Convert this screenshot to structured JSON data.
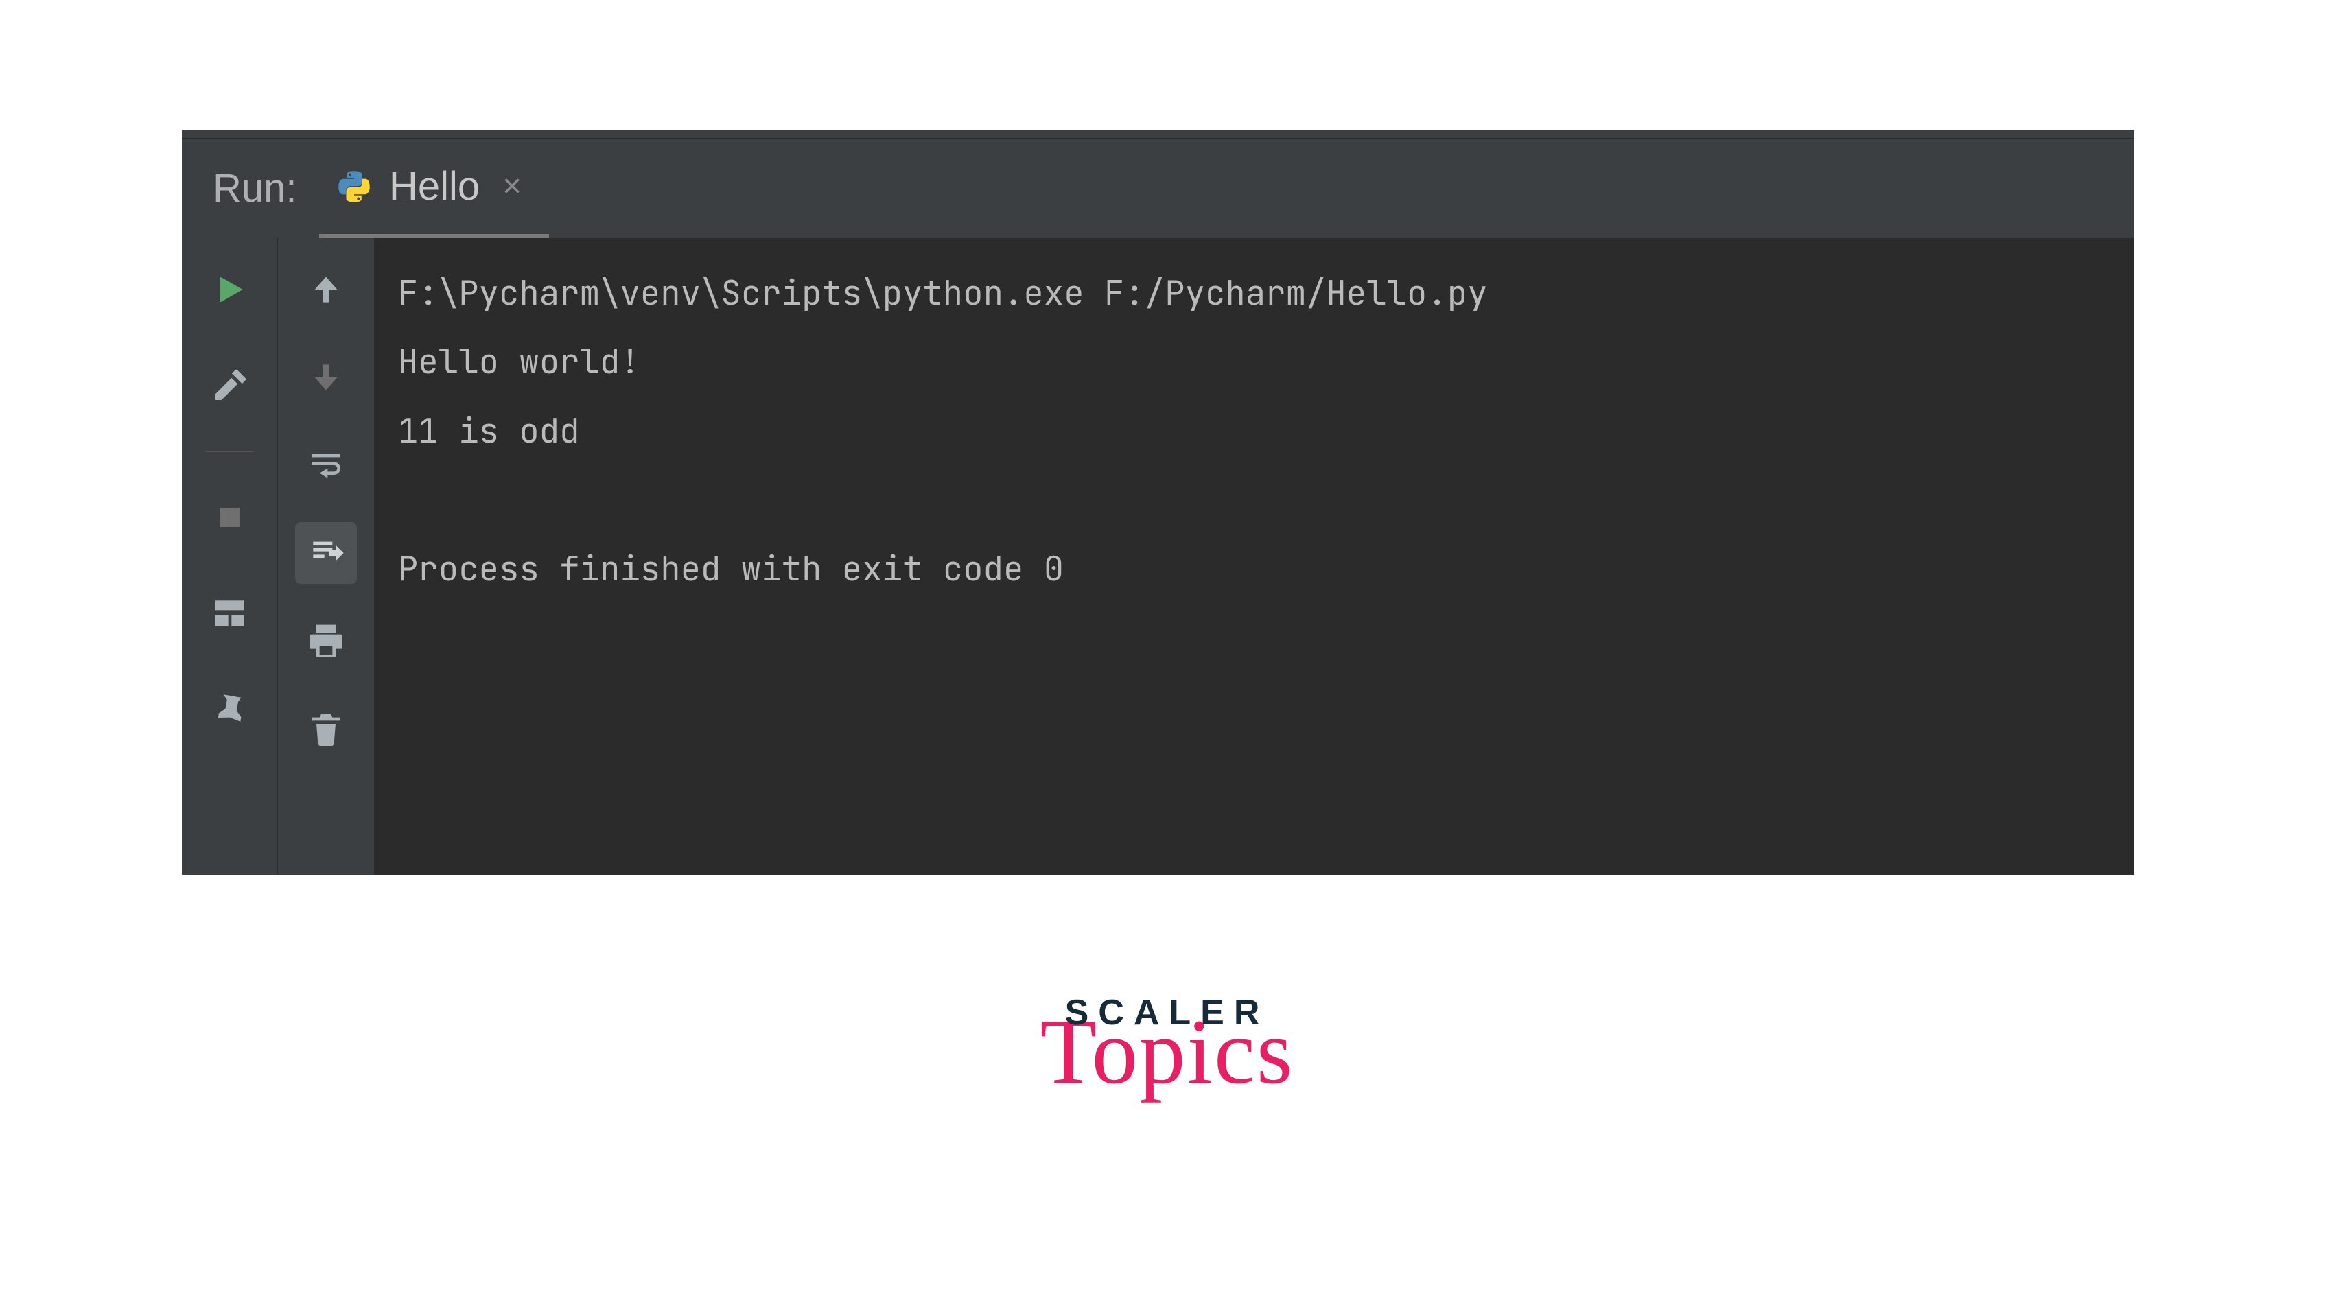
{
  "panel": {
    "run_label": "Run:",
    "tab": {
      "label": "Hello"
    }
  },
  "console": {
    "lines": [
      "F:\\Pycharm\\venv\\Scripts\\python.exe F:/Pycharm/Hello.py",
      "Hello world!",
      "11 is odd",
      "",
      "Process finished with exit code 0"
    ]
  },
  "toolbar_primary": [
    {
      "name": "run",
      "icon": "play"
    },
    {
      "name": "edit-config",
      "icon": "wrench"
    },
    {
      "name": "divider"
    },
    {
      "name": "stop",
      "icon": "stop"
    },
    {
      "name": "layout",
      "icon": "layout"
    },
    {
      "name": "pin",
      "icon": "pin"
    }
  ],
  "toolbar_secondary": [
    {
      "name": "up",
      "icon": "arrow-up"
    },
    {
      "name": "down",
      "icon": "arrow-down"
    },
    {
      "name": "soft-wrap",
      "icon": "wrap"
    },
    {
      "name": "scroll-to-end",
      "icon": "scroll-end",
      "active": true
    },
    {
      "name": "print",
      "icon": "print"
    },
    {
      "name": "clear-all",
      "icon": "trash"
    }
  ],
  "logo": {
    "line1": "SCALER",
    "line2": "Topics"
  }
}
